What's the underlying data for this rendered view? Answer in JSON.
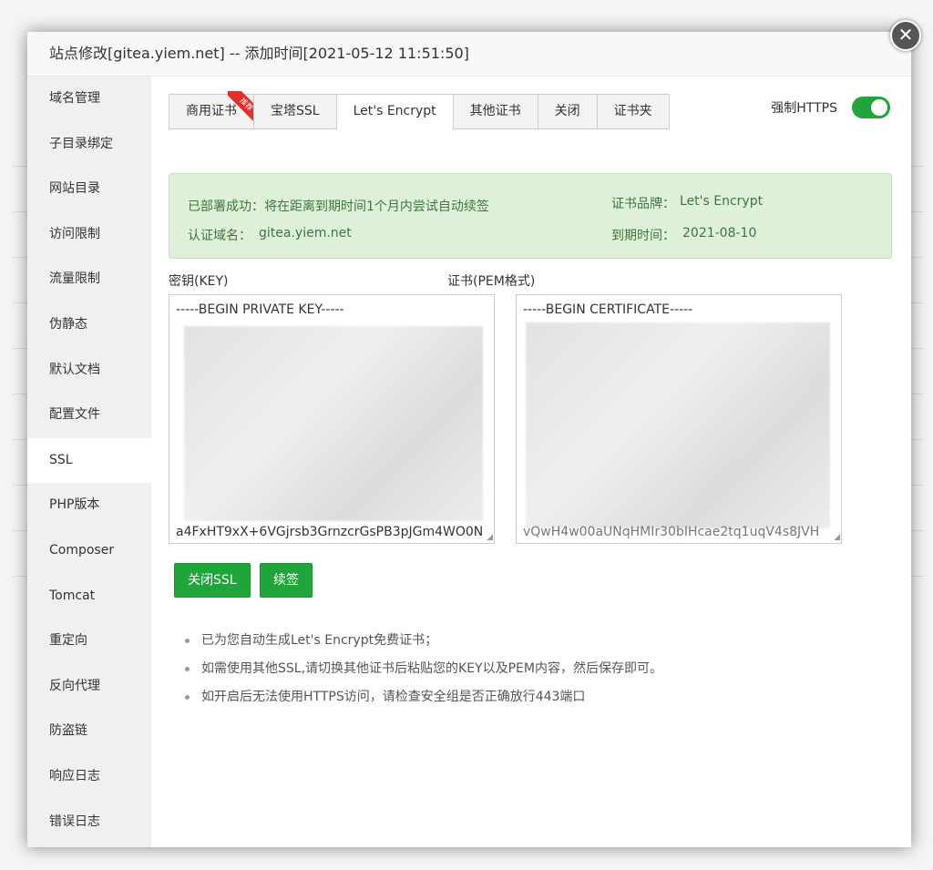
{
  "modal": {
    "title": "站点修改[gitea.yiem.net] -- 添加时间[2021-05-12 11:51:50]",
    "close_glyph": "✕"
  },
  "sidebar": {
    "items": [
      {
        "label": "域名管理"
      },
      {
        "label": "子目录绑定"
      },
      {
        "label": "网站目录"
      },
      {
        "label": "访问限制"
      },
      {
        "label": "流量限制"
      },
      {
        "label": "伪静态"
      },
      {
        "label": "默认文档"
      },
      {
        "label": "配置文件"
      },
      {
        "label": "SSL",
        "active": true
      },
      {
        "label": "PHP版本"
      },
      {
        "label": "Composer"
      },
      {
        "label": "Tomcat"
      },
      {
        "label": "重定向"
      },
      {
        "label": "反向代理"
      },
      {
        "label": "防盗链"
      },
      {
        "label": "响应日志"
      },
      {
        "label": "错误日志"
      }
    ]
  },
  "tabs": [
    {
      "label": "商用证书",
      "ribbon": "推荐"
    },
    {
      "label": "宝塔SSL"
    },
    {
      "label": "Let's Encrypt",
      "active": true
    },
    {
      "label": "其他证书"
    },
    {
      "label": "关闭"
    },
    {
      "label": "证书夹"
    }
  ],
  "force_https": {
    "label": "强制HTTPS",
    "enabled": true
  },
  "status": {
    "deploy_msg": "已部署成功：将在距离到期时间1个月内尝试自动续签",
    "domain_label": "认证域名：",
    "domain_value": "gitea.yiem.net",
    "brand_label": "证书品牌：",
    "brand_value": "Let's Encrypt",
    "expire_label": "到期时间：",
    "expire_value": "2021-08-10"
  },
  "key_field": {
    "label": "密钥(KEY)",
    "first_line": "-----BEGIN PRIVATE KEY-----",
    "last_line": "a4FxHT9xX+6VGjrsb3GrnzcrGsPB3pJGm4WO0N"
  },
  "cert_field": {
    "label": "证书(PEM格式)",
    "first_line": "-----BEGIN CERTIFICATE-----",
    "last_line": "vQwH4w00aUNqHMIr30bIHcae2tq1uqV4s8JVH"
  },
  "buttons": {
    "close_ssl": "关闭SSL",
    "renew": "续签"
  },
  "tips": [
    "已为您自动生成Let's Encrypt免费证书；",
    "如需使用其他SSL,请切换其他证书后粘贴您的KEY以及PEM内容，然后保存即可。",
    "如开启后无法使用HTTPS访问，请检查安全组是否正确放行443端口"
  ],
  "colors": {
    "accent": "#20a53a",
    "status_bg": "#dff0d8",
    "status_text": "#3c763d",
    "ribbon": "#e0302b"
  }
}
